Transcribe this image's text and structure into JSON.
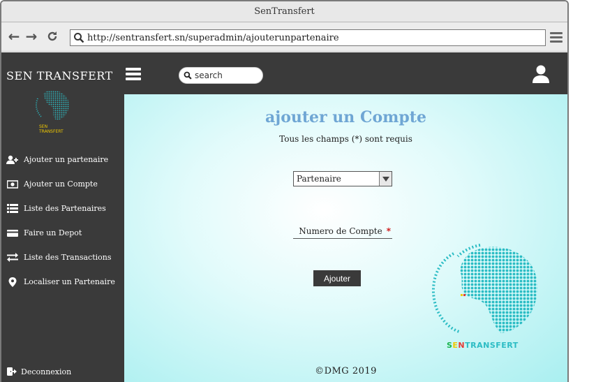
{
  "browser": {
    "window_title": "SenTransfert",
    "url": "http://sentransfert.sn/superadmin/ajouterunpartenaire"
  },
  "header": {
    "brand": "SEN TRANSFERT",
    "search_placeholder": "search"
  },
  "sidebar": {
    "logo_text": "SEN TRANSFERT",
    "items": [
      {
        "label": "Ajouter un partenaire",
        "icon": "user-plus-icon"
      },
      {
        "label": "Ajouter un Compte",
        "icon": "money-bill-icon"
      },
      {
        "label": "Liste des Partenaires",
        "icon": "list-icon"
      },
      {
        "label": "Faire un Depot",
        "icon": "credit-card-icon"
      },
      {
        "label": "Liste des Transactions",
        "icon": "exchange-arrows-icon"
      },
      {
        "label": "Localiser un Partenaire",
        "icon": "map-marker-icon"
      }
    ],
    "logout_label": "Deconnexion"
  },
  "form": {
    "title": "ajouter un Compte",
    "subtitle": "Tous les champs (*) sont requis",
    "select_value": "Partenaire",
    "field_label": "Numero de Compte",
    "required_mark": "*",
    "submit_label": "Ajouter"
  },
  "brand_logo": {
    "part1": "SEN",
    "part2": "TRANSFERT"
  },
  "footer": {
    "copyright": "©DMG 2019"
  },
  "colors": {
    "dark": "#3a3a3a",
    "title_blue": "#6fa6d4",
    "globe_teal": "#2bbcc4",
    "required_red": "#cc0000"
  }
}
